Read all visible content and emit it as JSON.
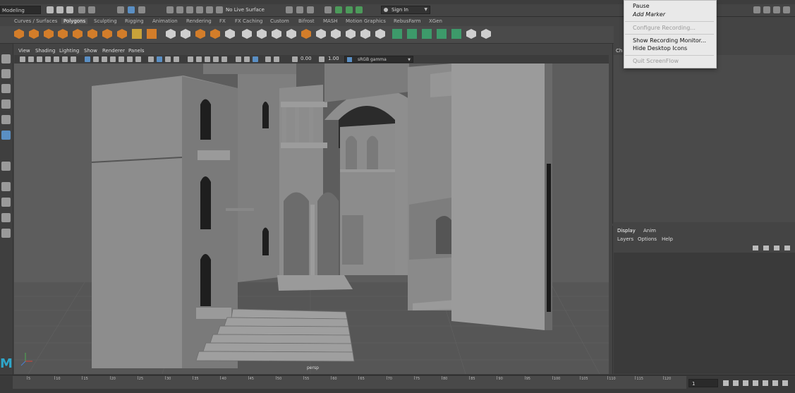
{
  "status_line": {
    "mode": "Modeling",
    "live_surface": "No Live Surface",
    "sign_in": "Sign In"
  },
  "shelf_tabs": [
    "Curves / Surfaces",
    "Polygons",
    "Sculpting",
    "Rigging",
    "Animation",
    "Rendering",
    "FX",
    "FX Caching",
    "Custom",
    "Bifrost",
    "MASH",
    "Motion Graphics",
    "RebusFarm",
    "XGen"
  ],
  "shelf_active_tab": "Polygons",
  "viewport": {
    "menus": [
      "View",
      "Shading",
      "Lighting",
      "Show",
      "Renderer",
      "Panels"
    ],
    "field_value_1": "0.00",
    "field_value_2": "1.00",
    "color_space": "sRGB gamma",
    "camera_label": "persp"
  },
  "context_menu": {
    "items": [
      {
        "label": "Pause",
        "state": "normal"
      },
      {
        "label": "Add Marker",
        "state": "italic"
      },
      {
        "label": "Configure Recording...",
        "state": "disabled"
      },
      {
        "label": "Show Recording Monitor...",
        "state": "normal"
      },
      {
        "label": "Hide Desktop Icons",
        "state": "normal"
      },
      {
        "label": "Quit ScreenFlow",
        "state": "disabled"
      }
    ]
  },
  "channel_box": {
    "tab": "Ch"
  },
  "layer_panel": {
    "tabs": [
      "Display",
      "Anim"
    ],
    "menus": [
      "Layers",
      "Options",
      "Help"
    ]
  },
  "timeline": {
    "ticks": [
      "5",
      "10",
      "15",
      "20",
      "25",
      "30",
      "35",
      "40",
      "45",
      "50",
      "55",
      "60",
      "65",
      "70",
      "75",
      "80",
      "85",
      "90",
      "95",
      "100",
      "105",
      "110",
      "115",
      "120"
    ],
    "current_frame": "1"
  },
  "colors": {
    "accent": "#d37d2a",
    "brand": "#2fa6c9"
  }
}
